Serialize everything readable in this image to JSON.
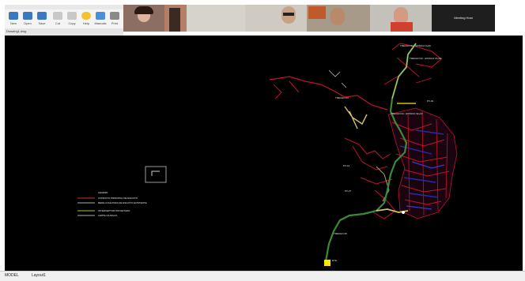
{
  "toolbar": {
    "buttons": [
      {
        "label": "New",
        "icon": "new-file-icon"
      },
      {
        "label": "Open",
        "icon": "open-folder-icon"
      },
      {
        "label": "Save",
        "icon": "save-icon"
      },
      {
        "label": "Cut",
        "icon": "cut-icon"
      },
      {
        "label": "Copy",
        "icon": "copy-icon"
      },
      {
        "label": "Help",
        "icon": "help-icon"
      },
      {
        "label": "Manuals",
        "icon": "book-icon"
      },
      {
        "label": "Print",
        "icon": "print-icon"
      }
    ]
  },
  "tab": {
    "label": "Drawing1.dwg"
  },
  "participants": [
    {
      "name": ""
    },
    {
      "name": ""
    },
    {
      "name": ""
    },
    {
      "name": ""
    },
    {
      "name": ""
    },
    {
      "name": "Meeting Host"
    }
  ],
  "legend": {
    "lines": [
      {
        "text": "LEGEND",
        "color": "#d8d8d8"
      },
      {
        "text": "CONDUTO PRINCIPAL DE ESGOTO",
        "color": "#c0392b"
      },
      {
        "text": "REDE COLETORA DE ESGOTO EXISTENTE",
        "color": "#e8e8e8"
      },
      {
        "text": "INTERCEPTOR PROJETADO",
        "color": "#9acd32"
      },
      {
        "text": "LIMITE DA BACIA",
        "color": "#e8e8e8"
      }
    ]
  },
  "drawing_labels": [
    "TRECHO 01 - ESTACA 0+00",
    "TRECHO 02 - ESTACA 15+00",
    "TRECHO 03",
    "PV-01",
    "TRECHO 04 - ESTACA 32+10",
    "PV-12",
    "PV-27",
    "TRECHO 05",
    "ETE"
  ],
  "status_bar": {
    "left": "MODEL",
    "layout": "Layout1"
  },
  "colors": {
    "canvas": "#000000",
    "network_red": "#c0142a",
    "network_blue": "#2a2aa8",
    "main_line": "#3a8a3a",
    "yellow": "#ffe600"
  }
}
